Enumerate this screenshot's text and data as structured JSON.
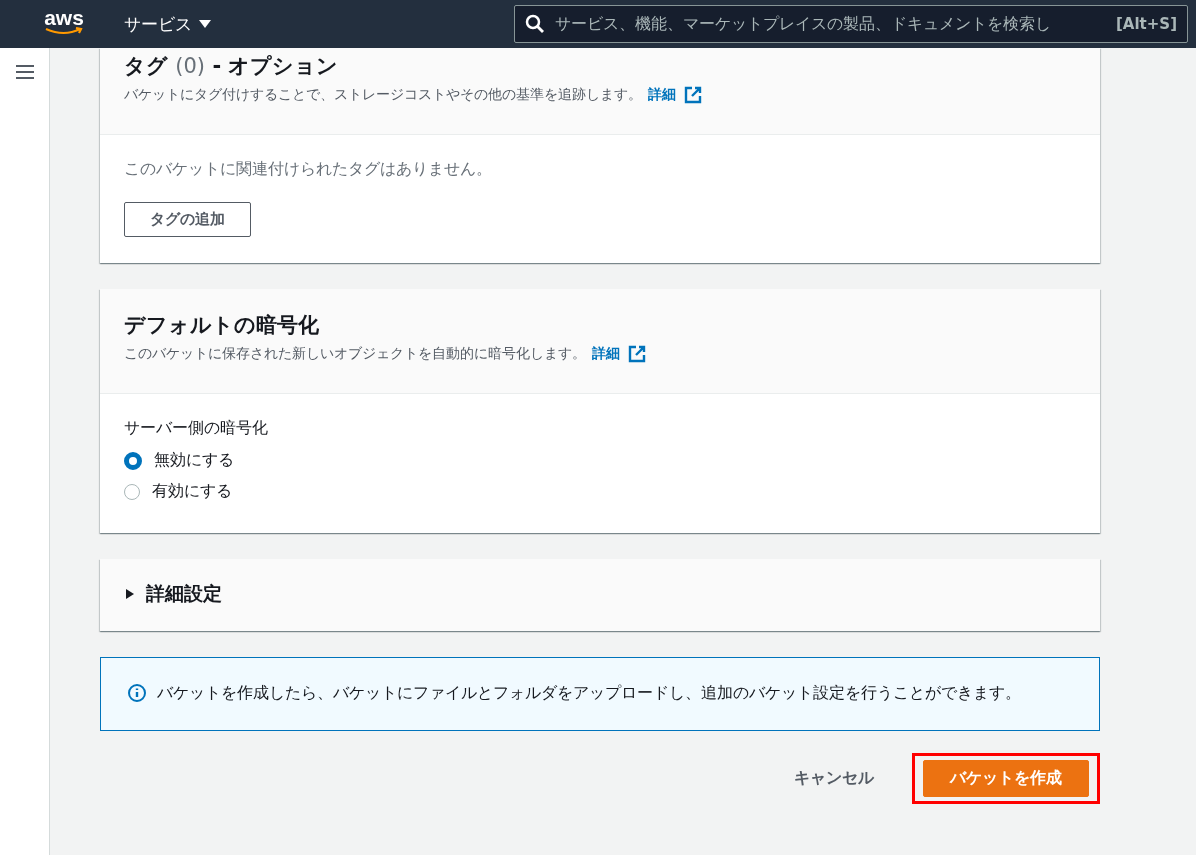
{
  "nav": {
    "logo": "aws",
    "services": "サービス",
    "search": {
      "placeholder": "サービス、機能、マーケットプレイスの製品、ドキュメントを検索し",
      "shortcut": "[Alt+S]"
    }
  },
  "tags": {
    "title": "タグ",
    "count": "(0)",
    "title_suffix": "- オプション",
    "description": "バケットにタグ付けすることで、ストレージコストやその他の基準を追跡します。",
    "link": "詳細",
    "empty": "このバケットに関連付けられたタグはありません。",
    "add_button": "タグの追加"
  },
  "encryption": {
    "title": "デフォルトの暗号化",
    "description": "このバケットに保存された新しいオブジェクトを自動的に暗号化します。",
    "link": "詳細",
    "label": "サーバー側の暗号化",
    "options": [
      {
        "label": "無効にする",
        "selected": true
      },
      {
        "label": "有効にする",
        "selected": false
      }
    ]
  },
  "advanced": {
    "title": "詳細設定",
    "expanded": false
  },
  "info": "バケットを作成したら、バケットにファイルとフォルダをアップロードし、追加のバケット設定を行うことができます。",
  "actions": {
    "cancel": "キャンセル",
    "create": "バケットを作成",
    "highlighted": true
  }
}
